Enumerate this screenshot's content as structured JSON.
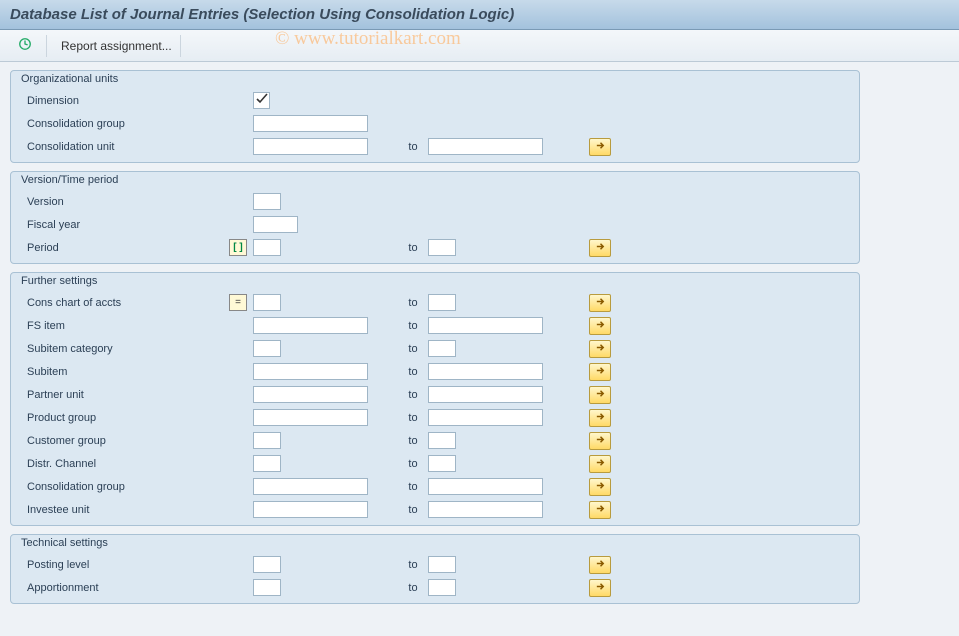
{
  "page": {
    "title": "Database List of Journal Entries (Selection Using Consolidation Logic)",
    "watermark": "© www.tutorialkart.com"
  },
  "toolbar": {
    "report_assignment": "Report assignment..."
  },
  "labels": {
    "to": "to"
  },
  "groups": {
    "org": {
      "title": "Organizational units",
      "dimension": "Dimension",
      "cons_group": "Consolidation group",
      "cons_unit": "Consolidation unit"
    },
    "version": {
      "title": "Version/Time period",
      "version": "Version",
      "fiscal_year": "Fiscal year",
      "period": "Period"
    },
    "further": {
      "title": "Further settings",
      "cons_chart": "Cons chart of accts",
      "fs_item": "FS item",
      "subitem_cat": "Subitem category",
      "subitem": "Subitem",
      "partner_unit": "Partner unit",
      "product_group": "Product group",
      "customer_group": "Customer group",
      "distr_channel": "Distr. Channel",
      "cons_group2": "Consolidation group",
      "investee_unit": "Investee unit"
    },
    "technical": {
      "title": "Technical settings",
      "posting_level": "Posting level",
      "apportionment": "Apportionment"
    }
  }
}
